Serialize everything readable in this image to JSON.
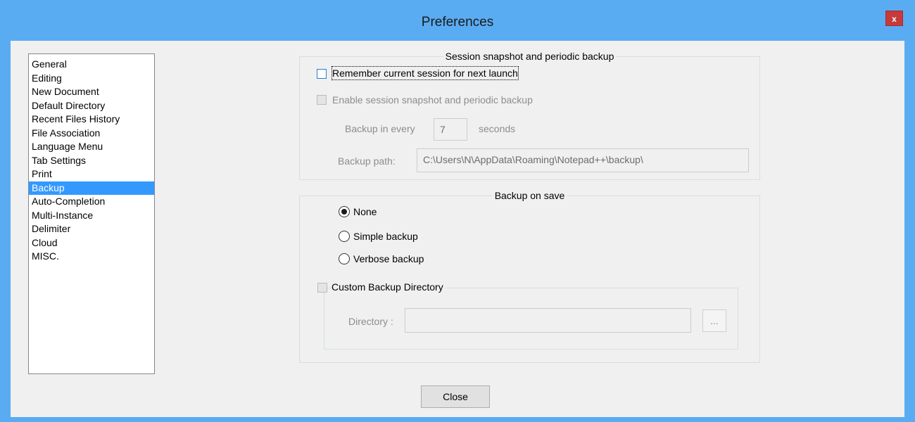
{
  "window": {
    "title": "Preferences",
    "close_glyph": "x"
  },
  "sidebar": {
    "items": [
      {
        "label": "General"
      },
      {
        "label": "Editing"
      },
      {
        "label": "New Document"
      },
      {
        "label": "Default Directory"
      },
      {
        "label": "Recent Files History"
      },
      {
        "label": "File Association"
      },
      {
        "label": "Language Menu"
      },
      {
        "label": "Tab Settings"
      },
      {
        "label": "Print"
      },
      {
        "label": "Backup"
      },
      {
        "label": "Auto-Completion"
      },
      {
        "label": "Multi-Instance"
      },
      {
        "label": "Delimiter"
      },
      {
        "label": "Cloud"
      },
      {
        "label": "MISC."
      }
    ],
    "selected": "Backup"
  },
  "session": {
    "group_title": "Session snapshot and periodic backup",
    "remember_label": "Remember current session for next launch",
    "remember_checked": false,
    "enable_label": "Enable session snapshot and periodic backup",
    "enable_checked": false,
    "backup_every_label": "Backup in every",
    "backup_every_value": "7",
    "seconds_label": "seconds",
    "backup_path_label": "Backup path:",
    "backup_path_value": "C:\\Users\\N\\AppData\\Roaming\\Notepad++\\backup\\"
  },
  "backup_on_save": {
    "group_title": "Backup on save",
    "options": [
      {
        "label": "None",
        "selected": true
      },
      {
        "label": "Simple backup",
        "selected": false
      },
      {
        "label": "Verbose backup",
        "selected": false
      }
    ],
    "custom_dir_label": "Custom Backup Directory",
    "custom_dir_checked": false,
    "directory_label": "Directory :",
    "directory_value": "",
    "browse_label": "..."
  },
  "footer": {
    "close_label": "Close"
  },
  "colors": {
    "titlebar": "#5aacf2",
    "selection": "#3399ff",
    "close_button": "#c73a3a"
  }
}
